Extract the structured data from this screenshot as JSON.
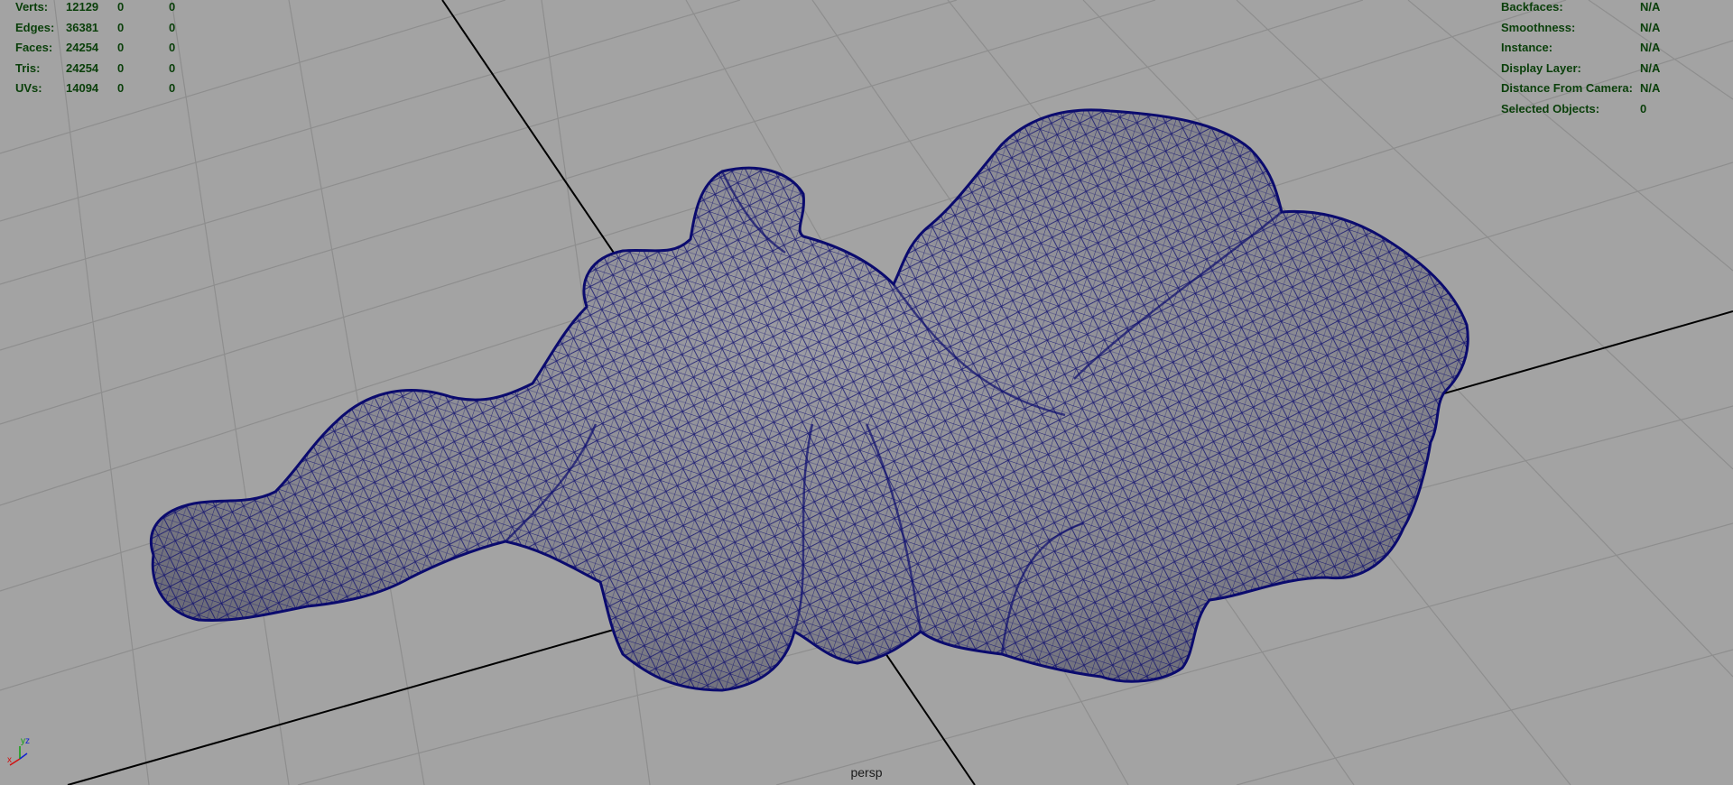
{
  "viewport": {
    "camera": "persp",
    "background_color": "#a3a3a3",
    "grid_color": "#8e8e8e",
    "axis_line_color": "#000000",
    "mesh_fill_color": "#8a8a90",
    "wireframe_color": "#0b0b6e",
    "hud_text_color": "#0a3f0a"
  },
  "poly_count_hud": {
    "rows": [
      {
        "label": "Verts:",
        "total": "12129",
        "selected": "0",
        "highlighted": "0"
      },
      {
        "label": "Edges:",
        "total": "36381",
        "selected": "0",
        "highlighted": "0"
      },
      {
        "label": "Faces:",
        "total": "24254",
        "selected": "0",
        "highlighted": "0"
      },
      {
        "label": "Tris:",
        "total": "24254",
        "selected": "0",
        "highlighted": "0"
      },
      {
        "label": "UVs:",
        "total": "14094",
        "selected": "0",
        "highlighted": "0"
      }
    ]
  },
  "object_details_hud": {
    "rows": [
      {
        "label": "Backfaces:",
        "value": "N/A"
      },
      {
        "label": "Smoothness:",
        "value": "N/A"
      },
      {
        "label": "Instance:",
        "value": "N/A"
      },
      {
        "label": "Display Layer:",
        "value": "N/A"
      },
      {
        "label": "Distance From Camera:",
        "value": "N/A"
      },
      {
        "label": "Selected Objects:",
        "value": "0"
      }
    ]
  },
  "axis_indicator": {
    "x": "x",
    "y": "y",
    "z": "z"
  }
}
